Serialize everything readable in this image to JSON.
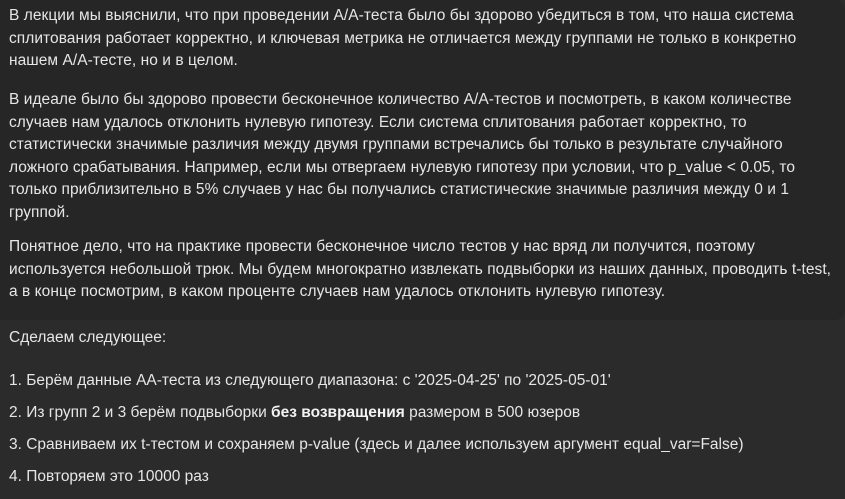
{
  "intro": {
    "paragraph1": "В лекции мы выяснили, что при проведении А/А-теста было бы здорово убедиться в том, что наша система сплитования работает корректно, и ключевая метрика не отличается между группами не только в конкретно нашем А/А-тесте, но и в целом.",
    "paragraph2": "В идеале было бы здорово провести бесконечное количество А/А-тестов и посмотреть, в каком количестве случаев нам удалось отклонить нулевую гипотезу. Если система сплитования работает корректно, то статистически значимые различия между двумя группами встречались бы только в результате случайного ложного срабатывания. Например, если мы отвергаем нулевую гипотезу при условии, что p_value < 0.05, то только приблизительно в 5% случаев у нас бы получались статистические значимые различия между 0 и 1 группой.",
    "paragraph3": "Понятное дело, что на практике провести бесконечное число тестов у нас вряд ли получится, поэтому используется небольшой трюк. Мы будем многократно извлекать подвыборки из наших данных, проводить t-test, а в конце посмотрим, в каком проценте случаев нам удалось отклонить нулевую гипотезу."
  },
  "steps": {
    "heading": "Сделаем следующее:",
    "step1": "1. Берём данные АА-теста из следующего диапазона: с '2025-04-25' по '2025-05-01'",
    "step2_before": "2. Из групп 2 и 3 берём подвыборки ",
    "step2_bold": "без возвращения",
    "step2_after": " размером в 500 юзеров",
    "step3": "3. Сравниваем их t-тестом и сохраняем p-value (здесь и далее используем аргумент equal_var=False)",
    "step4": "4. Повторяем это 10000 раз"
  }
}
